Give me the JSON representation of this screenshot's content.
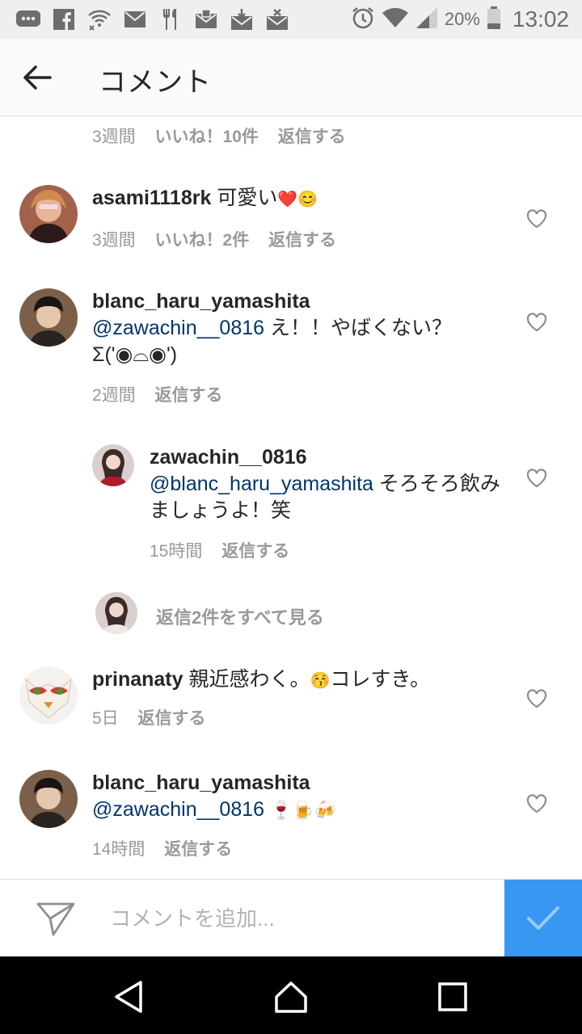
{
  "status": {
    "battery": "20%",
    "time": "13:02",
    "icons": [
      "chat-icon",
      "facebook-icon",
      "wifi-off-icon",
      "mail-icon",
      "restaurant-icon",
      "mail-alert-icon",
      "download-mail-icon",
      "mail-x-icon"
    ]
  },
  "header": {
    "title": "コメント"
  },
  "partial_meta": {
    "time": "3週間",
    "likes": "いいね！10件",
    "reply": "返信する"
  },
  "comments": [
    {
      "username": "asami1118rk",
      "text": " 可愛い",
      "emoji": "❤️😊",
      "time": "3週間",
      "likes": "いいね！2件",
      "reply": "返信する"
    },
    {
      "username": "blanc_haru_yamashita",
      "mention": "@zawachin__0816",
      "text": " え！！やばくない？Σ('◉⌓◉')",
      "time": "2週間",
      "reply": "返信する"
    },
    {
      "username": "zawachin__0816",
      "mention": "@blanc_haru_yamashita",
      "text": " そろそろ飲みましょうよ！笑",
      "time": "15時間",
      "reply": "返信する"
    },
    {
      "username": "prinanaty",
      "text": " 親近感わく。",
      "emoji": "😚",
      "text2": "コレすき。",
      "time": "5日",
      "reply": "返信する"
    },
    {
      "username": "blanc_haru_yamashita",
      "mention": "@zawachin__0816",
      "emoji": "🍷🍺🍻",
      "time": "14時間",
      "reply": "返信する"
    }
  ],
  "view_replies": "返信2件をすべて見る",
  "composer": {
    "placeholder": "コメントを追加..."
  },
  "colors": {
    "accent": "#3897f0",
    "mention": "#003569",
    "meta": "#999999"
  }
}
